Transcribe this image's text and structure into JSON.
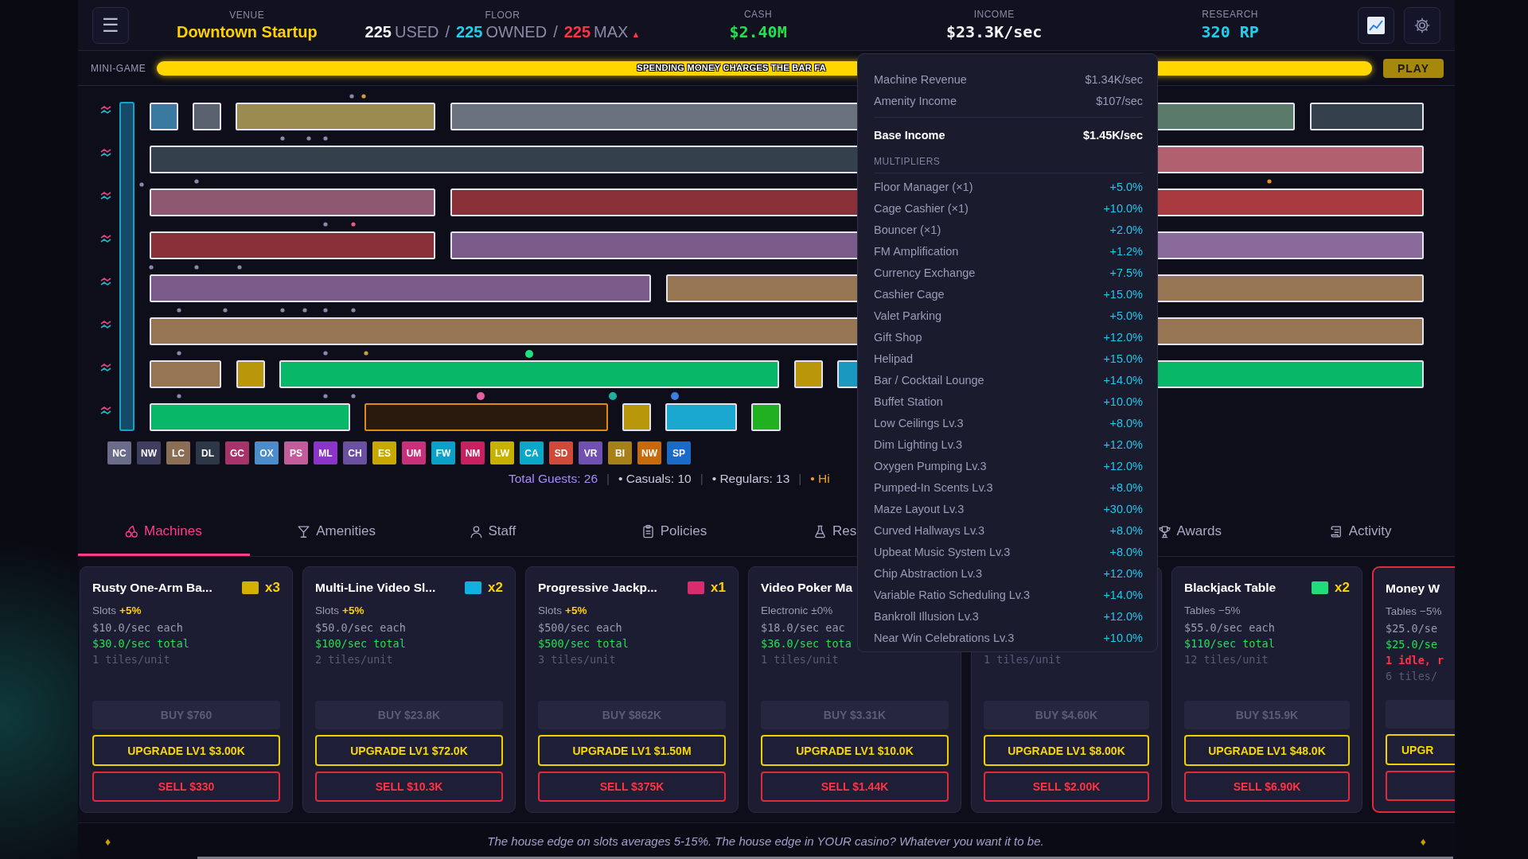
{
  "header": {
    "menu": "☰",
    "venue": {
      "label": "VENUE",
      "value": "Downtown Startup"
    },
    "floor": {
      "label": "FLOOR",
      "used": "225",
      "used_label": "USED",
      "owned": "225",
      "owned_label": "OWNED",
      "max": "225",
      "max_label": "MAX",
      "separator_1": "/",
      "separator_2": "/",
      "arrow": "▲"
    },
    "cash": {
      "label": "CASH",
      "value": "$2.40M"
    },
    "income": {
      "label": "INCOME",
      "value": "$23.3K/sec"
    },
    "research": {
      "label": "RESEARCH",
      "value": "320 RP"
    }
  },
  "minigame": {
    "label": "MINI-GAME",
    "level": 1,
    "caption": "SPENDING MONEY CHARGES THE BAR FA",
    "button": "PLAY"
  },
  "legend": [
    {
      "code": "NC",
      "color": "#6b6b8a"
    },
    {
      "code": "NW",
      "color": "#3e3e5e"
    },
    {
      "code": "LC",
      "color": "#8a6e55"
    },
    {
      "code": "DL",
      "color": "#2d3748"
    },
    {
      "code": "GC",
      "color": "#a8336a"
    },
    {
      "code": "OX",
      "color": "#4a8ccc"
    },
    {
      "code": "PS",
      "color": "#c45c9c"
    },
    {
      "code": "ML",
      "color": "#8b35c8"
    },
    {
      "code": "CH",
      "color": "#6b4fa0"
    },
    {
      "code": "ES",
      "color": "#c8a800"
    },
    {
      "code": "UM",
      "color": "#c8307a"
    },
    {
      "code": "FW",
      "color": "#0aa0c8"
    },
    {
      "code": "NM",
      "color": "#c82060"
    },
    {
      "code": "LW",
      "color": "#c8b000"
    },
    {
      "code": "CA",
      "color": "#0aa8c8"
    },
    {
      "code": "SD",
      "color": "#d04a3a"
    },
    {
      "code": "VR",
      "color": "#7050b0"
    },
    {
      "code": "BI",
      "color": "#a8801a"
    },
    {
      "code": "NW",
      "color": "#c86a0a"
    },
    {
      "code": "SP",
      "color": "#1a6ac8"
    }
  ],
  "guests": [
    {
      "kind": "total",
      "text": "Total Guests: 26"
    },
    {
      "kind": "separator",
      "text": "|"
    },
    {
      "kind": "plain",
      "text": "• Casuals: 10"
    },
    {
      "kind": "separator",
      "text": "|"
    },
    {
      "kind": "plain",
      "text": "• Regulars: 13"
    },
    {
      "kind": "separator",
      "text": "|"
    },
    {
      "kind": "high",
      "text": "• Hi"
    }
  ],
  "tabs": [
    {
      "label": "Machines",
      "selected": true
    },
    {
      "label": "Amenities",
      "selected": false
    },
    {
      "label": "Staff",
      "selected": false
    },
    {
      "label": "Policies",
      "selected": false
    },
    {
      "label": "Res",
      "selected": false
    },
    {
      "label": "Awards",
      "selected": false
    },
    {
      "label": "Activity",
      "selected": false
    }
  ],
  "tooltip": {
    "rows": [
      {
        "label": "Machine Revenue",
        "value": "$1.34K/sec"
      },
      {
        "label": "Amenity Income",
        "value": "$107/sec"
      }
    ],
    "base": {
      "label": "Base Income",
      "value": "$1.45K/sec"
    },
    "section": "MULTIPLIERS",
    "multipliers": [
      {
        "label": "Floor Manager (×1)",
        "value": "+5.0%"
      },
      {
        "label": "Cage Cashier (×1)",
        "value": "+10.0%"
      },
      {
        "label": "Bouncer (×1)",
        "value": "+2.0%"
      },
      {
        "label": "FM Amplification",
        "value": "+1.2%"
      },
      {
        "label": "Currency Exchange",
        "value": "+7.5%"
      },
      {
        "label": "Cashier Cage",
        "value": "+15.0%"
      },
      {
        "label": "Valet Parking",
        "value": "+5.0%"
      },
      {
        "label": "Gift Shop",
        "value": "+12.0%"
      },
      {
        "label": "Helipad",
        "value": "+15.0%"
      },
      {
        "label": "Bar / Cocktail Lounge",
        "value": "+14.0%"
      },
      {
        "label": "Buffet Station",
        "value": "+10.0%"
      },
      {
        "label": "Low Ceilings Lv.3",
        "value": "+8.0%"
      },
      {
        "label": "Dim Lighting Lv.3",
        "value": "+12.0%"
      },
      {
        "label": "Oxygen Pumping Lv.3",
        "value": "+12.0%"
      },
      {
        "label": "Pumped-In Scents Lv.3",
        "value": "+8.0%"
      },
      {
        "label": "Maze Layout Lv.3",
        "value": "+30.0%"
      },
      {
        "label": "Curved Hallways Lv.3",
        "value": "+8.0%"
      },
      {
        "label": "Upbeat Music System Lv.3",
        "value": "+8.0%"
      },
      {
        "label": "Chip Abstraction Lv.3",
        "value": "+12.0%"
      },
      {
        "label": "Variable Ratio Scheduling Lv.3",
        "value": "+14.0%"
      },
      {
        "label": "Bankroll Illusion Lv.3",
        "value": "+12.0%"
      },
      {
        "label": "Near Win Celebrations Lv.3",
        "value": "+10.0%"
      }
    ]
  },
  "cards": [
    {
      "title": "Rusty One-Arm Ba...",
      "color": "#d4b000",
      "count": "x3",
      "category": "Slots",
      "modifier": {
        "kind": "bonus",
        "text": "+5%"
      },
      "each": "$10.0/sec each",
      "total": "$30.0/sec total",
      "tiles": "1 tiles/unit",
      "buy": {
        "label": "BUY $760",
        "disabled": true
      },
      "upgrade": "UPGRADE LV1 $3.00K",
      "sell": "SELL $330",
      "alert": false
    },
    {
      "title": "Multi-Line Video Sl...",
      "color": "#10b0e0",
      "count": "x2",
      "category": "Slots",
      "modifier": {
        "kind": "bonus",
        "text": "+5%"
      },
      "each": "$50.0/sec each",
      "total": "$100/sec total",
      "tiles": "2 tiles/unit",
      "buy": {
        "label": "BUY $23.8K",
        "disabled": true
      },
      "upgrade": "UPGRADE LV1 $72.0K",
      "sell": "SELL $10.3K",
      "alert": false
    },
    {
      "title": "Progressive Jackp...",
      "color": "#d82c6c",
      "count": "x1",
      "category": "Slots",
      "modifier": {
        "kind": "bonus",
        "text": "+5%"
      },
      "each": "$500/sec each",
      "total": "$500/sec total",
      "tiles": "3 tiles/unit",
      "buy": {
        "label": "BUY $862K",
        "disabled": true
      },
      "upgrade": "UPGRADE LV1 $1.50M",
      "sell": "SELL $375K",
      "alert": false
    },
    {
      "title": "Video Poker Ma",
      "category": "Electronic",
      "modifier": {
        "kind": "neutral",
        "text": "±0%"
      },
      "each": "$18.0/sec eac",
      "total": "$36.0/sec tota",
      "tiles": "1 tiles/unit",
      "buy": {
        "label": "BUY $3.31K",
        "disabled": true
      },
      "upgrade": "UPGRADE LV1 $10.0K",
      "sell": "SELL $1.44K",
      "alert": false
    },
    {
      "tiles": "1 tiles/unit",
      "buy": {
        "label": "BUY $4.60K",
        "disabled": true
      },
      "upgrade": "UPGRADE LV1 $8.00K",
      "sell": "SELL $2.00K",
      "alert": false
    },
    {
      "title": "Blackjack Table",
      "color": "#22dd77",
      "count": "x2",
      "category": "Tables",
      "modifier": {
        "kind": "neutral",
        "text": "−5%"
      },
      "each": "$55.0/sec each",
      "total": "$110/sec total",
      "tiles": "12 tiles/unit",
      "buy": {
        "label": "BUY $15.9K",
        "disabled": true
      },
      "upgrade": "UPGRADE LV1 $48.0K",
      "sell": "SELL $6.90K",
      "alert": false
    },
    {
      "title": "Money W",
      "category": "Tables",
      "modifier": {
        "kind": "neutral",
        "text": "−5%"
      },
      "each": "$25.0/se",
      "total": "$25.0/se",
      "idle": "1 idle, r",
      "tiles": "6 tiles/",
      "buy": {
        "disabled": true
      },
      "upgrade": "UPGR",
      "alert": true
    }
  ],
  "footer": {
    "left": "♦",
    "tip": "The house edge on slots averages 5-15%. The house edge in YOUR casino? Whatever you want it to be.",
    "right": "♦"
  }
}
